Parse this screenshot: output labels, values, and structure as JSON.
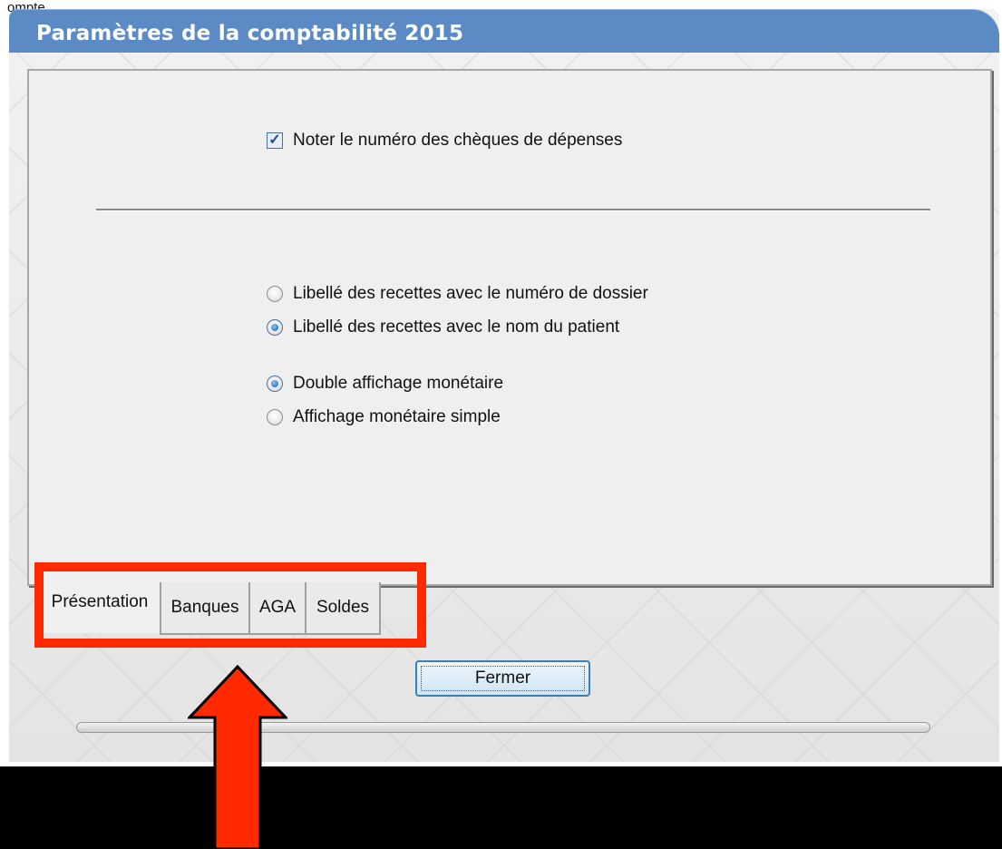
{
  "background_app": {
    "fragment_text": "ompte"
  },
  "dialog": {
    "title": "Paramètres de la comptabilité 2015",
    "checkbox": {
      "label": "Noter le numéro des chèques de dépenses",
      "checked": true,
      "check_glyph": "✓"
    },
    "radio_group_1": [
      {
        "label": "Libellé des recettes avec le numéro de dossier",
        "selected": false
      },
      {
        "label": "Libellé des recettes avec le nom du patient",
        "selected": true
      }
    ],
    "radio_group_2": [
      {
        "label": "Double affichage monétaire",
        "selected": true
      },
      {
        "label": "Affichage  monétaire simple",
        "selected": false
      }
    ],
    "tabs": [
      {
        "label": "Présentation",
        "active": true
      },
      {
        "label": "Banques",
        "active": false
      },
      {
        "label": "AGA",
        "active": false
      },
      {
        "label": "Soldes",
        "active": false
      }
    ],
    "close_button": "Fermer"
  },
  "annotation": {
    "color": "#ff2a00"
  },
  "colors": {
    "titlebar": "#5b8ac4",
    "accent": "#3c7fb1"
  }
}
